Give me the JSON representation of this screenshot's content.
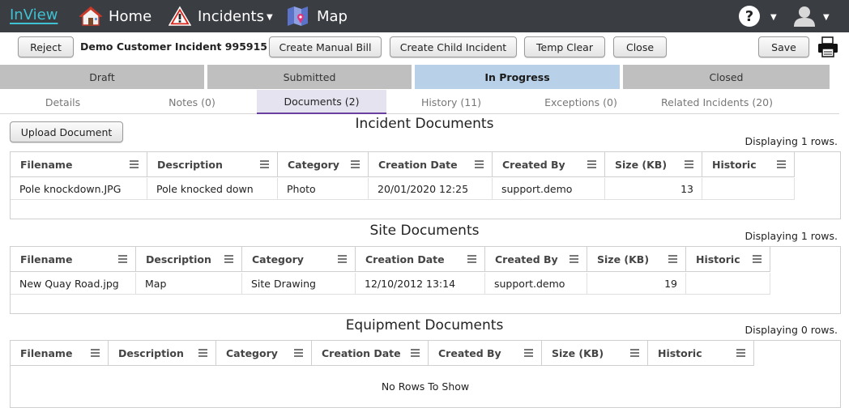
{
  "nav": {
    "brand": "InView",
    "home": "Home",
    "incidents": "Incidents",
    "map": "Map"
  },
  "toolbar": {
    "reject": "Reject",
    "incident_title": "Demo Customer Incident 995915",
    "create_manual_bill": "Create Manual Bill",
    "create_child_incident": "Create Child Incident",
    "temp_clear": "Temp Clear",
    "close": "Close",
    "save": "Save"
  },
  "statuses": [
    "Draft",
    "Submitted",
    "In Progress",
    "Closed"
  ],
  "tabs": [
    "Details",
    "Notes (0)",
    "Documents (2)",
    "History (11)",
    "Exceptions (0)",
    "Related Incidents (20)"
  ],
  "colors": {
    "nav_bg": "#3a3d42",
    "brand": "#3ec1d3",
    "status_active": "#b9d1e8",
    "tab_active_underline": "#6a3fa0",
    "warning_red": "#d9261c"
  },
  "sections": {
    "incident": {
      "title": "Incident Documents",
      "displaying": "Displaying 1 rows.",
      "columns": [
        "Filename",
        "Description",
        "Category",
        "Creation Date",
        "Created By",
        "Size (KB)",
        "Historic"
      ],
      "rows": [
        [
          "Pole knockdown.JPG",
          "Pole knocked down",
          "Photo",
          "20/01/2020 12:25",
          "support.demo",
          "13",
          ""
        ]
      ]
    },
    "site": {
      "title": "Site Documents",
      "displaying": "Displaying 1 rows.",
      "columns": [
        "Filename",
        "Description",
        "Category",
        "Creation Date",
        "Created By",
        "Size (KB)",
        "Historic"
      ],
      "rows": [
        [
          "New Quay Road.jpg",
          "Map",
          "Site Drawing",
          "12/10/2012 13:14",
          "support.demo",
          "19",
          ""
        ]
      ]
    },
    "equipment": {
      "title": "Equipment Documents",
      "displaying": "Displaying 0 rows.",
      "columns": [
        "Filename",
        "Description",
        "Category",
        "Creation Date",
        "Created By",
        "Size (KB)",
        "Historic"
      ],
      "no_rows": "No Rows To Show"
    }
  },
  "upload_button": "Upload Document"
}
